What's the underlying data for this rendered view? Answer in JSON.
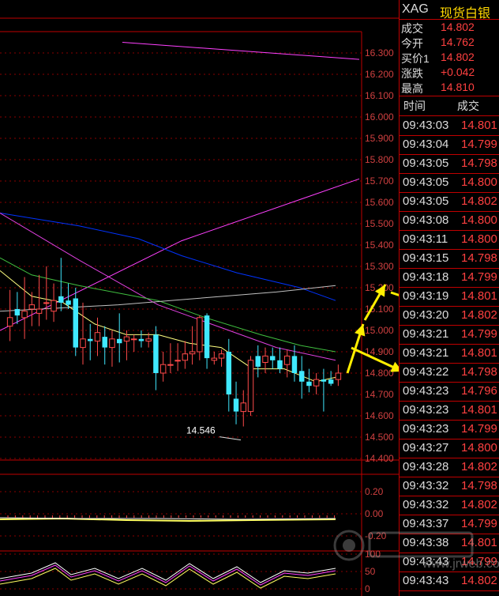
{
  "quote": {
    "code": "XAG",
    "name": "现货白银"
  },
  "stats": [
    {
      "label": "成交",
      "value": "14.802"
    },
    {
      "label": "今开",
      "value": "14.762"
    },
    {
      "label": "买价1",
      "value": "14.802"
    },
    {
      "label": "涨跌",
      "value": "+0.042"
    },
    {
      "label": "最高",
      "value": "14.810"
    }
  ],
  "ticks_header": {
    "time": "时间",
    "price": "成交"
  },
  "ticks": [
    {
      "time": "09:43:03",
      "price": "14.801"
    },
    {
      "time": "09:43:04",
      "price": "14.799"
    },
    {
      "time": "09:43:05",
      "price": "14.798"
    },
    {
      "time": "09:43:05",
      "price": "14.800"
    },
    {
      "time": "09:43:05",
      "price": "14.802"
    },
    {
      "time": "09:43:08",
      "price": "14.800"
    },
    {
      "time": "09:43:11",
      "price": "14.800"
    },
    {
      "time": "09:43:15",
      "price": "14.798"
    },
    {
      "time": "09:43:18",
      "price": "14.799"
    },
    {
      "time": "09:43:19",
      "price": "14.801"
    },
    {
      "time": "09:43:20",
      "price": "14.802"
    },
    {
      "time": "09:43:21",
      "price": "14.799"
    },
    {
      "time": "09:43:21",
      "price": "14.801"
    },
    {
      "time": "09:43:22",
      "price": "14.798"
    },
    {
      "time": "09:43:23",
      "price": "14.796"
    },
    {
      "time": "09:43:23",
      "price": "14.801"
    },
    {
      "time": "09:43:23",
      "price": "14.799"
    },
    {
      "time": "09:43:27",
      "price": "14.800"
    },
    {
      "time": "09:43:28",
      "price": "14.802"
    },
    {
      "time": "09:43:32",
      "price": "14.798"
    },
    {
      "time": "09:43:32",
      "price": "14.802"
    },
    {
      "time": "09:43:37",
      "price": "14.799"
    },
    {
      "time": "09:43:38",
      "price": "14.801"
    },
    {
      "time": "09:43:43",
      "price": "14.799"
    },
    {
      "time": "09:43:43",
      "price": "14.802"
    }
  ],
  "watermark": "www.jrweb.com",
  "chart_data": {
    "type": "candlestick",
    "ylim": [
      14.4,
      16.4
    ],
    "price_ticks": [
      "16.300",
      "16.200",
      "16.100",
      "16.000",
      "15.900",
      "15.800",
      "15.700",
      "15.600",
      "15.500",
      "15.400",
      "15.300",
      "15.200",
      "15.100",
      "15.000",
      "14.900",
      "14.800",
      "14.700",
      "14.600",
      "14.500",
      "14.400"
    ],
    "low_label": "14.546",
    "candles": [
      {
        "o": 15.02,
        "h": 15.19,
        "l": 14.95,
        "c": 15.06
      },
      {
        "o": 15.1,
        "h": 15.18,
        "l": 15.03,
        "c": 15.07
      },
      {
        "o": 15.06,
        "h": 15.25,
        "l": 14.96,
        "c": 15.09
      },
      {
        "o": 15.1,
        "h": 15.18,
        "l": 15.02,
        "c": 15.12
      },
      {
        "o": 15.08,
        "h": 15.26,
        "l": 15.02,
        "c": 15.1
      },
      {
        "o": 15.13,
        "h": 15.3,
        "l": 15.05,
        "c": 15.13
      },
      {
        "o": 15.09,
        "h": 15.22,
        "l": 15.04,
        "c": 15.14
      },
      {
        "o": 15.16,
        "h": 15.34,
        "l": 15.09,
        "c": 15.13
      },
      {
        "o": 15.14,
        "h": 15.22,
        "l": 15.1,
        "c": 15.12
      },
      {
        "o": 15.15,
        "h": 15.2,
        "l": 14.88,
        "c": 14.92
      },
      {
        "o": 14.92,
        "h": 15.13,
        "l": 14.84,
        "c": 14.96
      },
      {
        "o": 14.96,
        "h": 15.03,
        "l": 14.86,
        "c": 14.95
      },
      {
        "o": 14.95,
        "h": 15.06,
        "l": 14.88,
        "c": 14.99
      },
      {
        "o": 14.97,
        "h": 15.02,
        "l": 14.84,
        "c": 14.92
      },
      {
        "o": 14.92,
        "h": 15.0,
        "l": 14.83,
        "c": 14.96
      },
      {
        "o": 14.96,
        "h": 15.08,
        "l": 14.85,
        "c": 14.94
      },
      {
        "o": 14.95,
        "h": 15.0,
        "l": 14.86,
        "c": 14.97
      },
      {
        "o": 14.96,
        "h": 14.98,
        "l": 14.9,
        "c": 14.96
      },
      {
        "o": 14.96,
        "h": 15.0,
        "l": 14.92,
        "c": 14.95
      },
      {
        "o": 14.95,
        "h": 14.99,
        "l": 14.92,
        "c": 14.96
      },
      {
        "o": 14.98,
        "h": 15.02,
        "l": 14.72,
        "c": 14.8
      },
      {
        "o": 14.8,
        "h": 14.9,
        "l": 14.76,
        "c": 14.84
      },
      {
        "o": 14.84,
        "h": 14.94,
        "l": 14.8,
        "c": 14.84
      },
      {
        "o": 14.86,
        "h": 14.94,
        "l": 14.81,
        "c": 14.86
      },
      {
        "o": 14.86,
        "h": 14.95,
        "l": 14.82,
        "c": 14.89
      },
      {
        "o": 14.89,
        "h": 15.02,
        "l": 14.84,
        "c": 14.9
      },
      {
        "o": 14.9,
        "h": 15.07,
        "l": 14.86,
        "c": 15.06
      },
      {
        "o": 15.07,
        "h": 15.08,
        "l": 14.82,
        "c": 14.87
      },
      {
        "o": 14.86,
        "h": 14.9,
        "l": 14.84,
        "c": 14.87
      },
      {
        "o": 14.87,
        "h": 14.91,
        "l": 14.83,
        "c": 14.89
      },
      {
        "o": 14.9,
        "h": 14.96,
        "l": 14.62,
        "c": 14.7
      },
      {
        "o": 14.68,
        "h": 14.76,
        "l": 14.56,
        "c": 14.62
      },
      {
        "o": 14.62,
        "h": 14.72,
        "l": 14.55,
        "c": 14.66
      },
      {
        "o": 14.62,
        "h": 14.88,
        "l": 14.6,
        "c": 14.86
      },
      {
        "o": 14.88,
        "h": 14.93,
        "l": 14.78,
        "c": 14.83
      },
      {
        "o": 14.85,
        "h": 14.92,
        "l": 14.8,
        "c": 14.88
      },
      {
        "o": 14.88,
        "h": 14.92,
        "l": 14.82,
        "c": 14.86
      },
      {
        "o": 14.86,
        "h": 14.92,
        "l": 14.8,
        "c": 14.82
      },
      {
        "o": 14.84,
        "h": 14.91,
        "l": 14.78,
        "c": 14.88
      },
      {
        "o": 14.88,
        "h": 14.93,
        "l": 14.76,
        "c": 14.8
      },
      {
        "o": 14.81,
        "h": 14.88,
        "l": 14.68,
        "c": 14.76
      },
      {
        "o": 14.76,
        "h": 14.82,
        "l": 14.71,
        "c": 14.74
      },
      {
        "o": 14.74,
        "h": 14.8,
        "l": 14.7,
        "c": 14.77
      },
      {
        "o": 14.77,
        "h": 14.82,
        "l": 14.62,
        "c": 14.76
      },
      {
        "o": 14.77,
        "h": 14.81,
        "l": 14.74,
        "c": 14.75
      },
      {
        "o": 14.77,
        "h": 14.84,
        "l": 14.74,
        "c": 14.8
      }
    ],
    "lines": [
      {
        "color": "#ff40ff",
        "points": [
          [
            155,
            16.35
          ],
          [
            455,
            16.27
          ]
        ]
      },
      {
        "color": "#ff40ff",
        "points": [
          [
            0,
            15.0
          ],
          [
            230,
            15.42
          ],
          [
            455,
            15.71
          ]
        ]
      },
      {
        "color": "#0033ff",
        "points": [
          [
            0,
            15.55
          ],
          [
            100,
            15.49
          ],
          [
            175,
            15.43
          ],
          [
            230,
            15.35
          ],
          [
            300,
            15.27
          ],
          [
            380,
            15.2
          ],
          [
            425,
            15.14
          ]
        ]
      },
      {
        "color": "#e040e0",
        "points": [
          [
            0,
            15.55
          ],
          [
            100,
            15.33
          ],
          [
            200,
            15.12
          ],
          [
            275,
            15.02
          ],
          [
            350,
            14.92
          ],
          [
            425,
            14.86
          ]
        ]
      },
      {
        "color": "#40c040",
        "points": [
          [
            0,
            15.34
          ],
          [
            40,
            15.26
          ],
          [
            100,
            15.21
          ],
          [
            200,
            15.14
          ],
          [
            260,
            15.06
          ],
          [
            330,
            14.98
          ],
          [
            380,
            14.93
          ],
          [
            425,
            14.9
          ]
        ]
      },
      {
        "color": "#c0c0c0",
        "points": [
          [
            0,
            15.09
          ],
          [
            50,
            15.1
          ],
          [
            150,
            15.12
          ],
          [
            250,
            15.15
          ],
          [
            350,
            15.18
          ],
          [
            425,
            15.21
          ]
        ]
      },
      {
        "color": "#ffff80",
        "points": [
          [
            0,
            15.28
          ],
          [
            40,
            15.16
          ],
          [
            80,
            15.13
          ],
          [
            120,
            15.03
          ],
          [
            160,
            14.98
          ],
          [
            200,
            14.98
          ],
          [
            240,
            14.94
          ],
          [
            280,
            14.92
          ],
          [
            320,
            14.82
          ],
          [
            360,
            14.82
          ],
          [
            400,
            14.76
          ],
          [
            425,
            14.78
          ]
        ]
      }
    ],
    "macd_ticks": [
      "0.20",
      "0.00",
      "-0.20"
    ],
    "kdj_ticks": [
      "100",
      "50",
      "0"
    ]
  }
}
